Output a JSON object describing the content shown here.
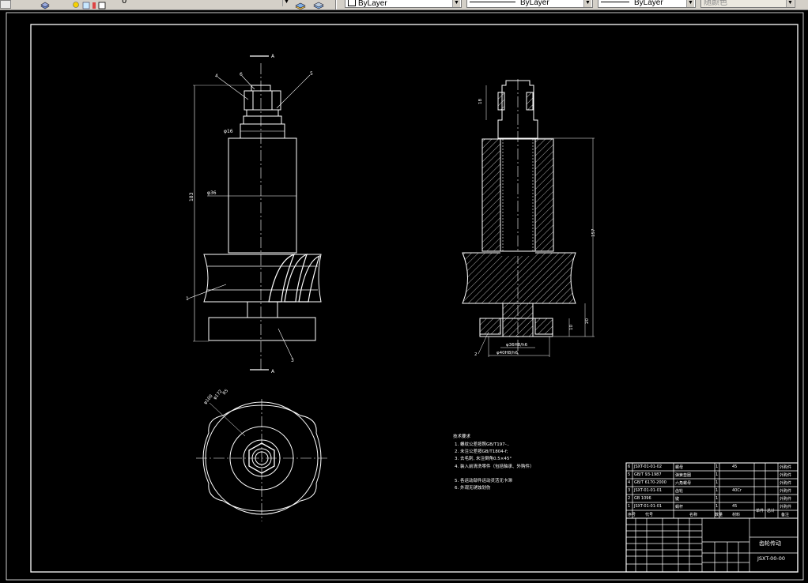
{
  "toolbar": {
    "layer_value": "0",
    "color_combo": "ByLayer",
    "linetype_combo": "ByLayer",
    "lineweight_combo": "ByLayer",
    "plotstyle_combo": "随颜色"
  },
  "drawing": {
    "front_view": {
      "balloons": [
        "4",
        "6",
        "5",
        "1",
        "3"
      ],
      "dims": {
        "overall_height": "183",
        "upper_dia": "φ36",
        "thread": "φ16"
      }
    },
    "section_view": {
      "dims": {
        "height": "157",
        "top": "18",
        "bottom1": "20",
        "bottom2": "10",
        "dia1": "φ36H8/h6",
        "dia2": "φ40H8/h6"
      },
      "balloons": [
        "2"
      ]
    },
    "section_markers": [
      "A",
      "A"
    ],
    "top_view": {
      "dims": [
        "φ100",
        "φ172",
        "R5"
      ]
    },
    "tech_notes": {
      "title": "技术要求",
      "items": [
        "1. 螺纹公差按照GB/T197-..",
        "2. 未注公差按GB/T1804-f;",
        "3. 去毛刺, 未注倒角0.5×45°",
        "4. 装入前清洗零件（包括轴承、外购件）",
        "5. 各运动部件运动灵活无卡滞",
        "6. 外观无锈蚀划伤"
      ]
    },
    "title_block": {
      "drawing_name": "齿轮传动",
      "drawing_number": "JSXT-00-00",
      "bom_rows": [
        {
          "no": "6",
          "code": "JSXT-01-01-02",
          "name": "螺母",
          "qty": "1",
          "mat": "45",
          "note": "外购件"
        },
        {
          "no": "5",
          "code": "GB/T 93-1987",
          "name": "弹簧垫圈",
          "qty": "1",
          "mat": "",
          "note": "外购件"
        },
        {
          "no": "4",
          "code": "GB/T 6170-2000",
          "name": "六角螺母",
          "qty": "1",
          "mat": "",
          "note": "外购件"
        },
        {
          "no": "3",
          "code": "JSXT-01-01-01",
          "name": "齿轮",
          "qty": "1",
          "mat": "40Cr",
          "note": "外购件"
        },
        {
          "no": "2",
          "code": "GB 1096",
          "name": "键",
          "qty": "1",
          "mat": "",
          "note": "外购件"
        },
        {
          "no": "1",
          "code": "JSXT-01-01-01",
          "name": "蜗杆",
          "qty": "1",
          "mat": "45",
          "note": "外购件"
        }
      ],
      "header": [
        "序号",
        "代号",
        "名称",
        "数量",
        "材料",
        "单件",
        "总计",
        "备注"
      ]
    }
  }
}
